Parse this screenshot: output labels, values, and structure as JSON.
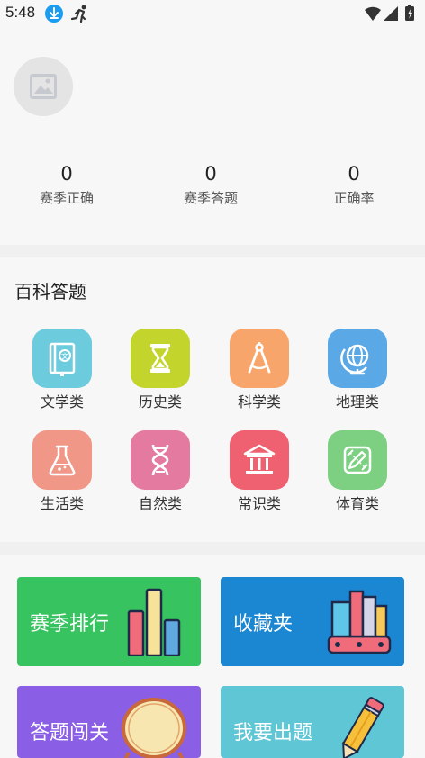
{
  "status_bar": {
    "time": "5:48"
  },
  "stats": [
    {
      "value": "0",
      "label": "赛季正确"
    },
    {
      "value": "0",
      "label": "赛季答题"
    },
    {
      "value": "0",
      "label": "正确率"
    }
  ],
  "section_title": "百科答题",
  "categories": [
    {
      "label": "文学类",
      "color": "#6ccbdc",
      "icon": "book-icon"
    },
    {
      "label": "历史类",
      "color": "#c3d42d",
      "icon": "hourglass-icon"
    },
    {
      "label": "科学类",
      "color": "#f7a56a",
      "icon": "compass-icon"
    },
    {
      "label": "地理类",
      "color": "#5aa8e5",
      "icon": "globe-icon"
    },
    {
      "label": "生活类",
      "color": "#f19787",
      "icon": "flask-icon"
    },
    {
      "label": "自然类",
      "color": "#e57aa0",
      "icon": "dna-icon"
    },
    {
      "label": "常识类",
      "color": "#ef6070",
      "icon": "bank-icon"
    },
    {
      "label": "体育类",
      "color": "#7dcf82",
      "icon": "ruler-pencil-icon"
    }
  ],
  "cards": [
    {
      "label": "赛季排行",
      "color": "#37c35f"
    },
    {
      "label": "收藏夹",
      "color": "#1b87d3"
    },
    {
      "label": "答题闯关",
      "color": "#8b5ee6"
    },
    {
      "label": "我要出题",
      "color": "#5fc6d5"
    }
  ]
}
